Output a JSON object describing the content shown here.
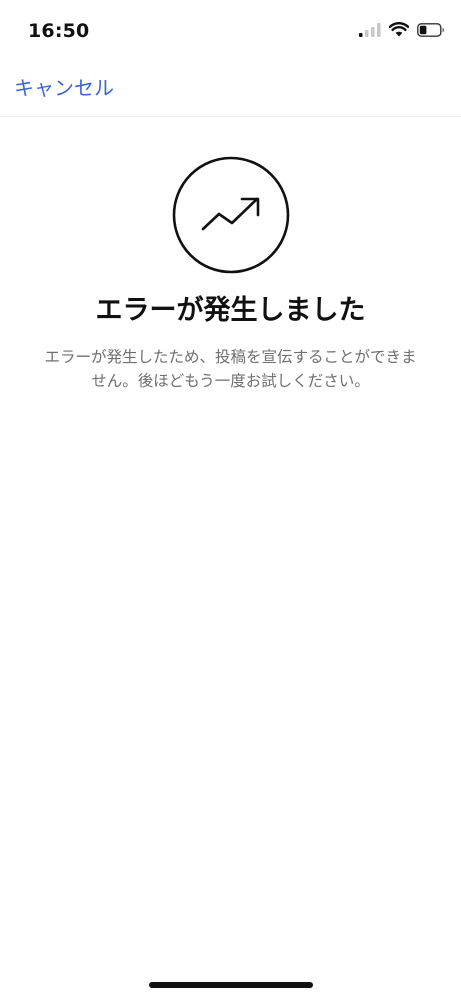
{
  "status_bar": {
    "time": "16:50",
    "icons": [
      "cellular-signal-icon",
      "wifi-icon",
      "battery-icon"
    ],
    "battery_level": 0.35
  },
  "nav": {
    "cancel_label": "キャンセル"
  },
  "error": {
    "icon": "trending-up-icon",
    "title": "エラーが発生しました",
    "message": "エラーが発生したため、投稿を宣伝することができません。後ほどもう一度お試しください。"
  },
  "colors": {
    "accent": "#3f64d6",
    "text_primary": "#111111",
    "text_secondary": "#6f6f6f",
    "background": "#ffffff"
  }
}
